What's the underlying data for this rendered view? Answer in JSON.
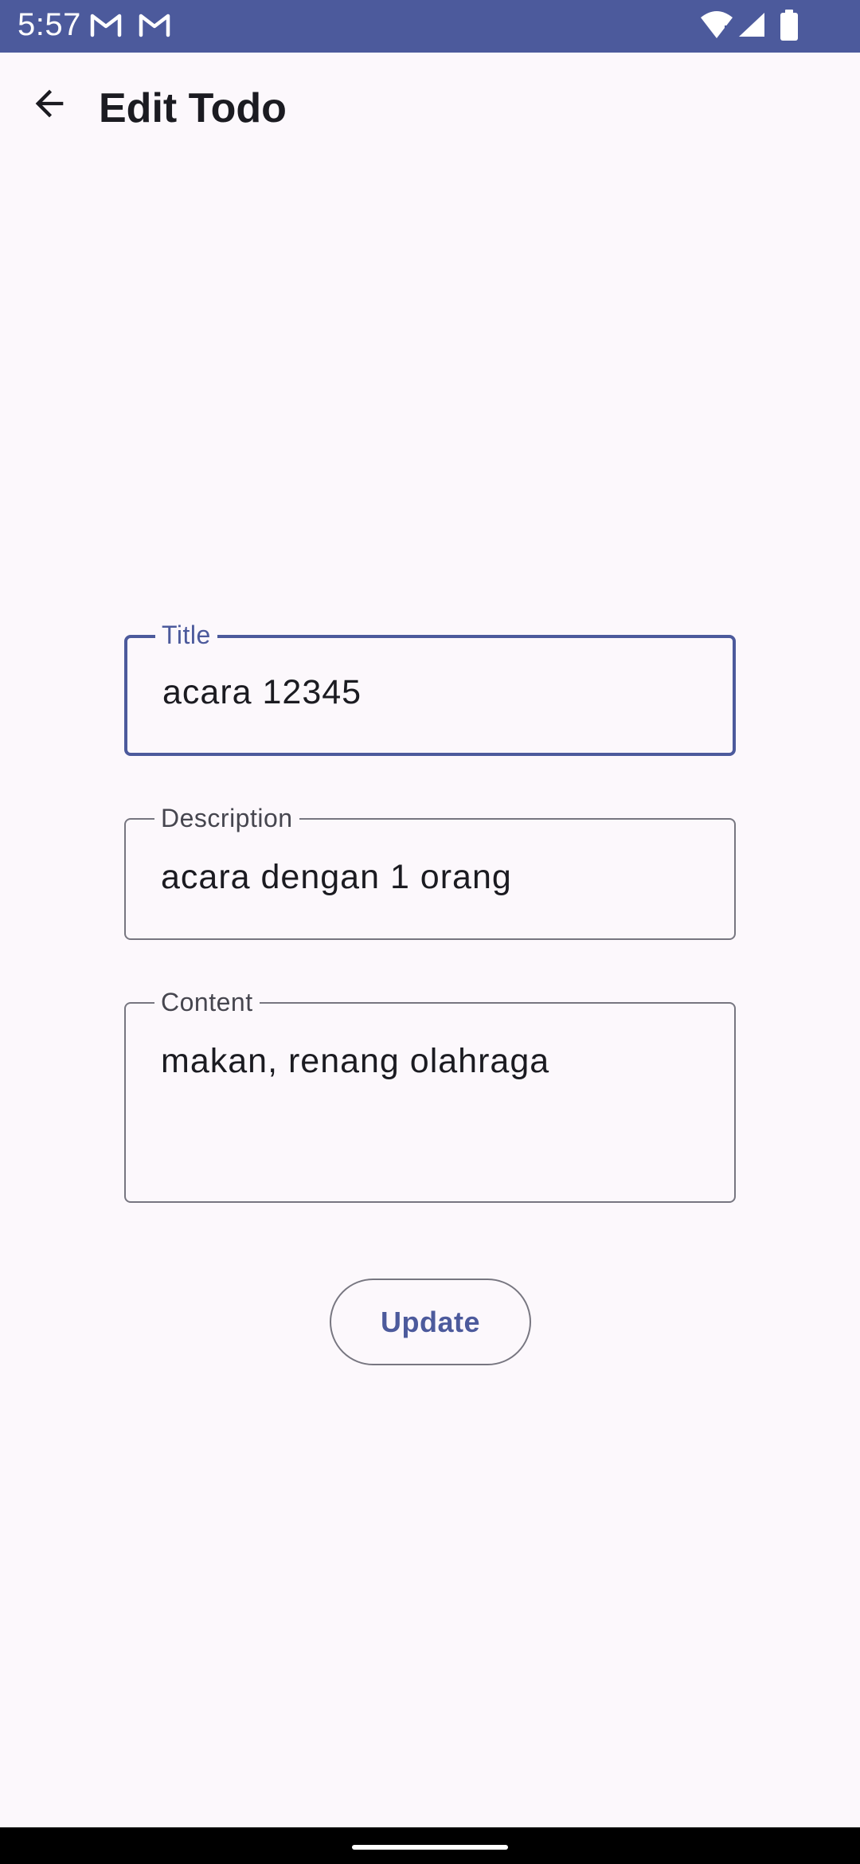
{
  "status_bar": {
    "time": "5:57",
    "notification_icons": [
      "gmail-icon",
      "gmail-icon"
    ],
    "system_icons": [
      "wifi-icon",
      "signal-icon",
      "battery-icon"
    ],
    "background_color": "#4c5a9c"
  },
  "app_bar": {
    "back_icon": "arrow-back-icon",
    "title": "Edit Todo"
  },
  "form": {
    "title_field": {
      "label": "Title",
      "value": "acara 12345",
      "focused": true
    },
    "description_field": {
      "label": "Description",
      "value": "acara dengan 1 orang",
      "focused": false
    },
    "content_field": {
      "label": "Content",
      "value": "makan, renang olahraga",
      "focused": false
    }
  },
  "actions": {
    "update_label": "Update"
  },
  "colors": {
    "accent": "#4c5a9c",
    "background": "#fcf8fc",
    "outline": "#777680",
    "text": "#1b1b21"
  }
}
